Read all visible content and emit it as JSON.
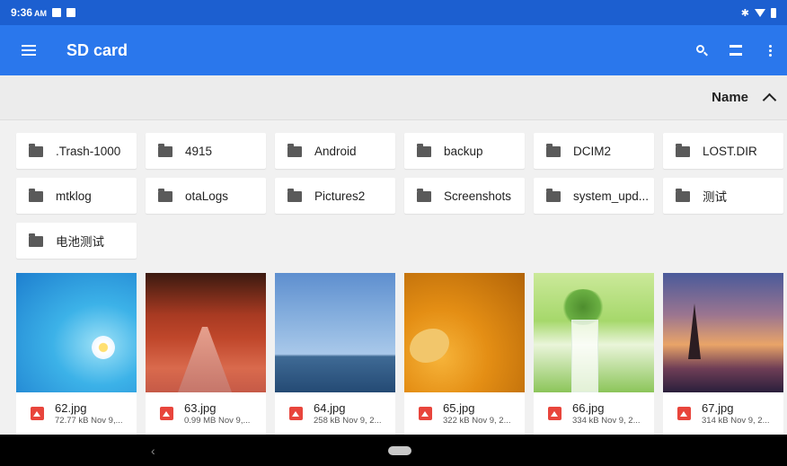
{
  "status_bar": {
    "time": "9:36",
    "ampm": "AM",
    "bluetooth": "✱"
  },
  "app_bar": {
    "title": "SD card"
  },
  "sort": {
    "label": "Name"
  },
  "folders": [
    ".Trash-1000",
    "4915",
    "Android",
    "backup",
    "DCIM2",
    "LOST.DIR",
    "mtklog",
    "otaLogs",
    "Pictures2",
    "Screenshots",
    "system_upd...",
    "测试",
    "电池测试"
  ],
  "photos": [
    {
      "name": "62.jpg",
      "info": "72.77 kB Nov 9,..."
    },
    {
      "name": "63.jpg",
      "info": "0.99 MB Nov 9,..."
    },
    {
      "name": "64.jpg",
      "info": "258 kB Nov 9, 2..."
    },
    {
      "name": "65.jpg",
      "info": "322 kB Nov 9, 2..."
    },
    {
      "name": "66.jpg",
      "info": "334 kB Nov 9, 2..."
    },
    {
      "name": "67.jpg",
      "info": "314 kB Nov 9, 2..."
    }
  ],
  "nav": {
    "back": "‹"
  },
  "colors": {
    "status_bar": "#1c5fd0",
    "app_bar": "#2a77ec",
    "image_icon": "#e8453c"
  }
}
